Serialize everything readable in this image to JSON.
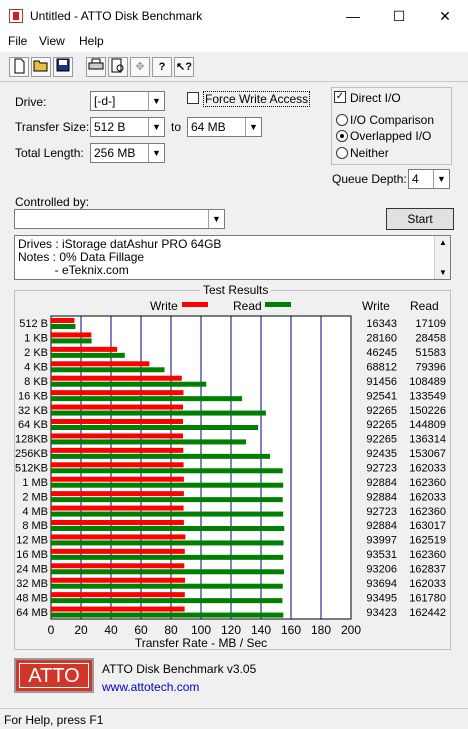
{
  "window": {
    "title": "Untitled - ATTO Disk Benchmark"
  },
  "titlebar_buttons": {
    "minimize": "—",
    "maximize": "☐",
    "close": "✕"
  },
  "menu": [
    "File",
    "View",
    "Help"
  ],
  "toolbar_icons": [
    "new-icon",
    "open-icon",
    "save-icon",
    "print-icon",
    "print-preview-icon",
    "move-icon",
    "help-icon",
    "context-help-icon"
  ],
  "form": {
    "drive_label": "Drive:",
    "drive_value": "[-d-]",
    "force_write_label": "Force Write Access",
    "force_write_checked": false,
    "direct_io_label": "Direct I/O",
    "direct_io_checked": true,
    "transfer_size_label": "Transfer Size:",
    "transfer_from": "512 B",
    "to_label": "to",
    "transfer_to": "64 MB",
    "total_length_label": "Total Length:",
    "total_length": "256 MB",
    "io_options": [
      {
        "label": "I/O Comparison",
        "selected": false
      },
      {
        "label": "Overlapped I/O",
        "selected": true
      },
      {
        "label": "Neither",
        "selected": false
      }
    ],
    "queue_depth_label": "Queue Depth:",
    "queue_depth": "4",
    "controlled_by_label": "Controlled by:",
    "controlled_by_value": "",
    "start_label": "Start"
  },
  "notes": {
    "line1": "Drives : iStorage datAshur PRO 64GB",
    "line2": "Notes : 0% Data Fillage",
    "line3": "           - eTeknix.com"
  },
  "colors": {
    "write": "#ff0000",
    "read": "#008000",
    "atto_brand": "#d0362a"
  },
  "chart_data": {
    "type": "bar",
    "title": "Test Results",
    "xlabel": "Transfer Rate - MB / Sec",
    "xlim": [
      0,
      200
    ],
    "xticks": [
      0,
      20,
      40,
      60,
      80,
      100,
      120,
      140,
      160,
      180,
      200
    ],
    "legend": [
      "Write",
      "Read"
    ],
    "table_headers": [
      "Write",
      "Read"
    ],
    "categories": [
      "512 B",
      "1 KB",
      "2 KB",
      "4 KB",
      "8 KB",
      "16 KB",
      "32 KB",
      "64 KB",
      "128KB",
      "256KB",
      "512KB",
      "1 MB",
      "2 MB",
      "4 MB",
      "8 MB",
      "12 MB",
      "16 MB",
      "24 MB",
      "32 MB",
      "48 MB",
      "64 MB"
    ],
    "series": [
      {
        "name": "Write",
        "values": [
          16343,
          28160,
          46245,
          68812,
          91456,
          92541,
          92265,
          92265,
          92265,
          92435,
          92723,
          92884,
          92884,
          92723,
          92884,
          93997,
          93531,
          93206,
          93694,
          93495,
          93423
        ]
      },
      {
        "name": "Read",
        "values": [
          17109,
          28458,
          51583,
          79396,
          108489,
          133549,
          150226,
          144809,
          136314,
          153067,
          162033,
          162360,
          162033,
          162360,
          163017,
          162519,
          162360,
          162837,
          162033,
          161780,
          162442
        ]
      }
    ],
    "bar_values_mb": {
      "write": [
        15.6,
        26.9,
        44.1,
        65.6,
        87.2,
        88.3,
        88.0,
        88.0,
        88.0,
        88.2,
        88.4,
        88.6,
        88.6,
        88.4,
        88.6,
        89.6,
        89.2,
        88.9,
        89.4,
        89.2,
        89.1
      ],
      "read": [
        16.3,
        27.1,
        49.2,
        75.7,
        103.5,
        127.4,
        143.3,
        138.1,
        130.0,
        146.0,
        154.5,
        154.8,
        154.5,
        154.8,
        155.5,
        155.0,
        154.8,
        155.3,
        154.5,
        154.3,
        154.9
      ]
    }
  },
  "footer": {
    "product": "ATTO Disk Benchmark v3.05",
    "link": "www.attotech.com",
    "logo": "ATTO"
  },
  "status": "For Help, press F1"
}
